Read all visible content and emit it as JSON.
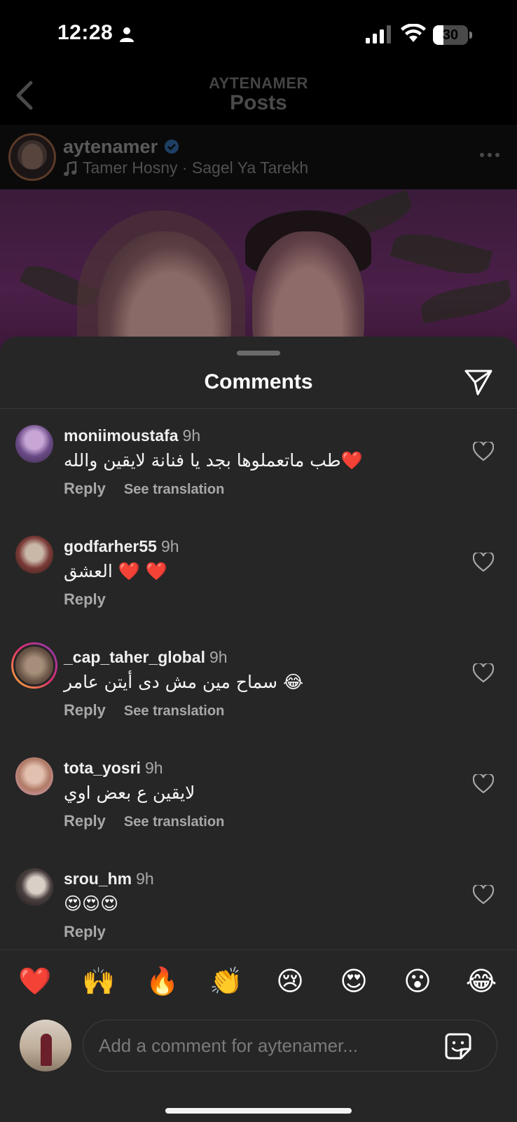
{
  "status_bar": {
    "time": "12:28",
    "battery": "30",
    "battery_level_percent": 30
  },
  "header": {
    "account": "AYTENAMER",
    "title": "Posts"
  },
  "post": {
    "username": "aytenamer",
    "song": "Tamer Hosny · Sagel Ya Tarekh"
  },
  "sheet": {
    "title": "Comments"
  },
  "comments": [
    {
      "user": "moniimoustafa",
      "time": "9h",
      "text": "طب ماتعملوها بجد يا فنانة لايقين والله❤️",
      "reply": "Reply",
      "translation": "See translation"
    },
    {
      "user": "godfarher55",
      "time": "9h",
      "text": "العشق ❤️ ❤️",
      "reply": "Reply"
    },
    {
      "user": "_cap_taher_global",
      "time": "9h",
      "text": "سماح مين مش دى أيتن عامر 😂",
      "reply": "Reply",
      "translation": "See translation"
    },
    {
      "user": "tota_yosri",
      "time": "9h",
      "text": "لايقين ع بعض اوي",
      "reply": "Reply",
      "translation": "See translation"
    },
    {
      "user": "srou_hm",
      "time": "9h",
      "text": "😍😍😍",
      "reply": "Reply"
    }
  ],
  "emoji_bar": [
    "❤️",
    "🙌",
    "🔥",
    "👏",
    "😢",
    "😍",
    "😮",
    "😂"
  ],
  "composer": {
    "placeholder": "Add a comment for aytenamer..."
  },
  "colors": {
    "background": "#000000",
    "sheet": "#262626",
    "secondary_text": "#a8a8a8",
    "verified": "#3897f0"
  }
}
